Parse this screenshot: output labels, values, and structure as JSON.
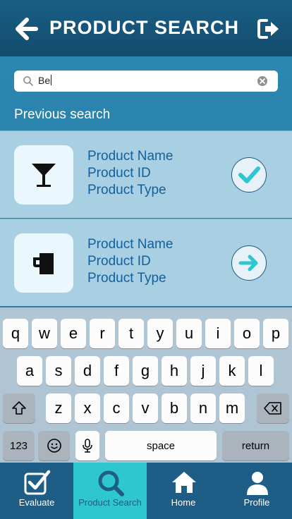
{
  "header": {
    "title": "PRODUCT SEARCH"
  },
  "search": {
    "value": "Be",
    "placeholder": ""
  },
  "previous_label": "Previous search",
  "results": [
    {
      "name": "Product Name",
      "id": "Product ID",
      "type": "Product Type",
      "icon": "cocktail-glass-icon",
      "action": "check-icon"
    },
    {
      "name": "Product Name",
      "id": "Product ID",
      "type": "Product Type",
      "icon": "mug-icon",
      "action": "arrow-right-icon"
    }
  ],
  "keyboard": {
    "row1": [
      "q",
      "w",
      "e",
      "r",
      "t",
      "y",
      "u",
      "i",
      "o",
      "p"
    ],
    "row2": [
      "a",
      "s",
      "d",
      "f",
      "g",
      "h",
      "j",
      "k",
      "l"
    ],
    "row3": [
      "z",
      "x",
      "c",
      "v",
      "b",
      "n",
      "m"
    ],
    "numbers": "123",
    "space": "space",
    "return": "return"
  },
  "tabs": [
    {
      "label": "Evaluate"
    },
    {
      "label": "Product Search"
    },
    {
      "label": "Home"
    },
    {
      "label": "Profile"
    }
  ],
  "colors": {
    "header": "#134b6d",
    "accent": "#2fc7cf",
    "tabbar": "#1d5d86"
  }
}
